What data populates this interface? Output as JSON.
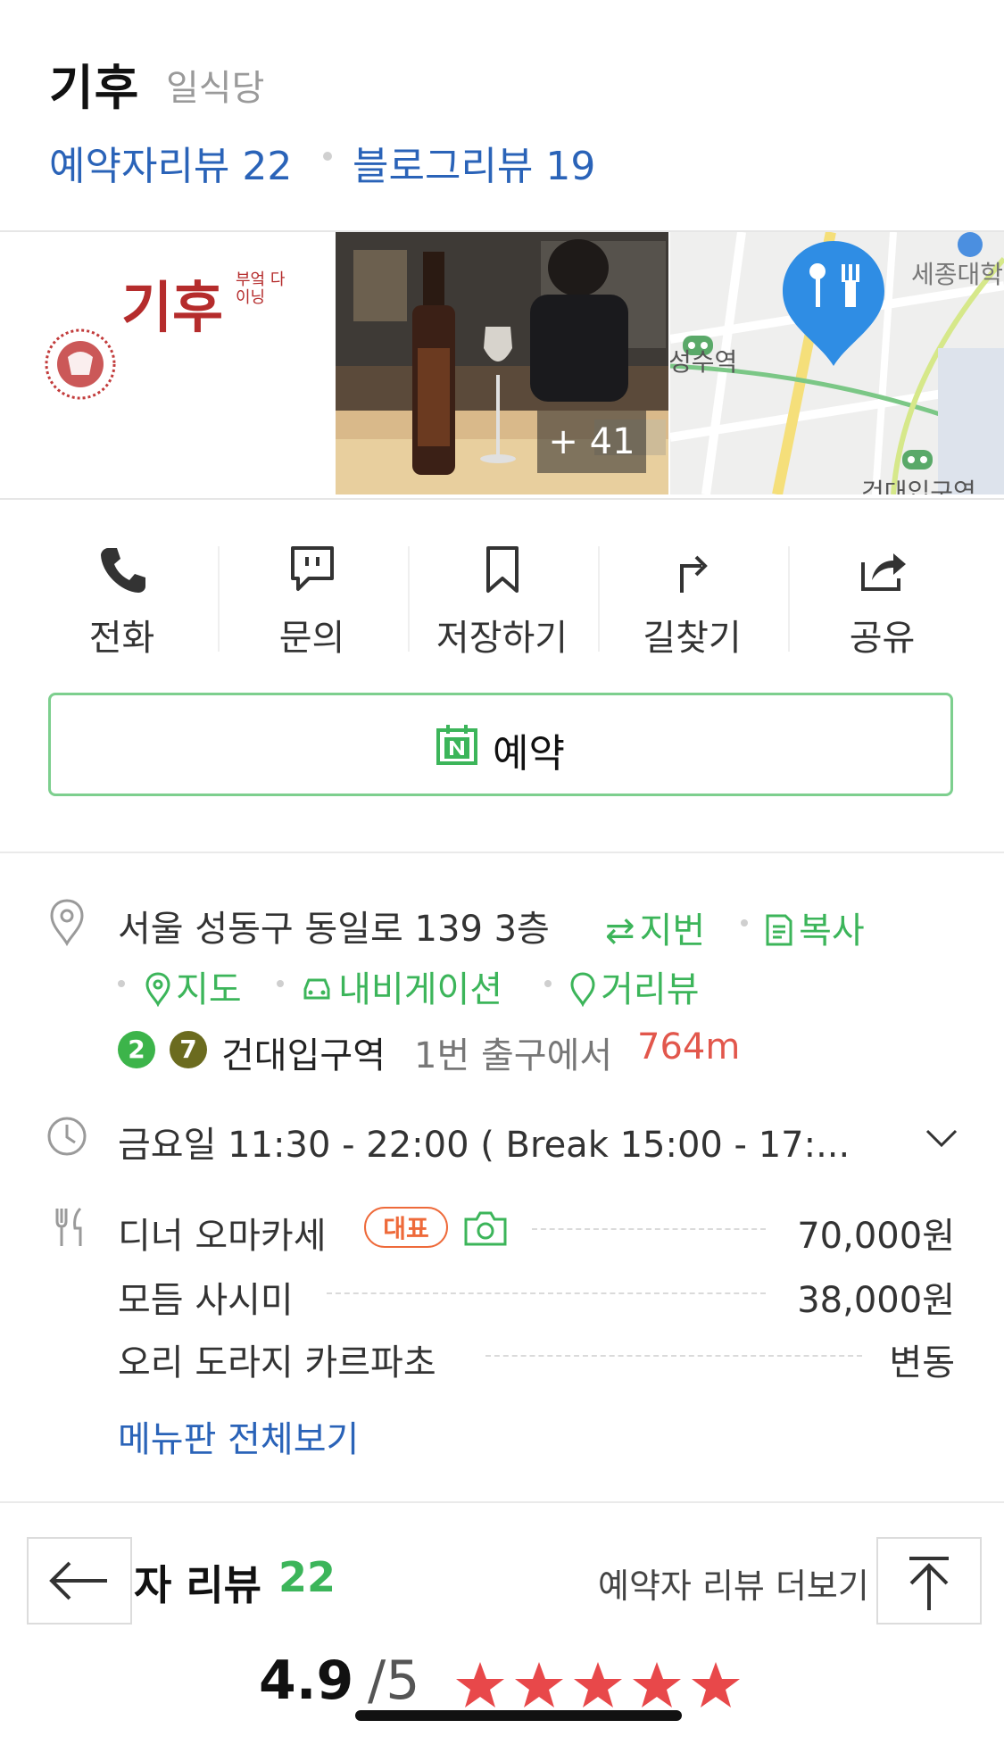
{
  "place": {
    "name": "기후",
    "category": "일식당",
    "booking_review_label": "예약자리뷰 22",
    "blog_review_label": "블로그리뷰 19"
  },
  "media": {
    "logo_text": "기후",
    "logo_sub": "부엌 다이닝",
    "photo_count_label": "+ 41",
    "map_labels": [
      "세종대학",
      "성수역",
      "건대입구역"
    ]
  },
  "actions": [
    {
      "label": "전화",
      "icon": "phone-icon"
    },
    {
      "label": "문의",
      "icon": "chat-icon"
    },
    {
      "label": "저장하기",
      "icon": "bookmark-icon"
    },
    {
      "label": "길찾기",
      "icon": "directions-icon"
    },
    {
      "label": "공유",
      "icon": "share-icon"
    }
  ],
  "reserve": {
    "label": "예약",
    "icon": "naver-booking-icon"
  },
  "address": {
    "text": "서울 성동구 동일로 139 3층",
    "jibun_label": "지번",
    "copy_label": "복사",
    "map_label": "지도",
    "navigation_label": "내비게이션",
    "streetview_label": "거리뷰"
  },
  "subway": {
    "lines": [
      "2",
      "7"
    ],
    "line_colors": [
      "#3cb44a",
      "#6b6b1f"
    ],
    "station": "건대입구역",
    "exit_text": "1번 출구에서",
    "distance": "764m"
  },
  "hours": {
    "text": "금요일 11:30 - 22:00 ( Break 15:00 - 17:..."
  },
  "menu": {
    "items": [
      {
        "name": "디너 오마카세",
        "price": "70,000원",
        "badge": "대표"
      },
      {
        "name": "모듬 사시미",
        "price": "38,000원"
      },
      {
        "name": "오리 도라지 카르파초",
        "price": "변동"
      }
    ],
    "view_all_label": "메뉴판 전체보기"
  },
  "reviews": {
    "title_visible": "자 리뷰",
    "count": "22",
    "more_label": "예약자 리뷰 더보기",
    "rating": "4.9",
    "rating_max": "/5",
    "stars": 5
  },
  "colors": {
    "accent_blue": "#2a63b8",
    "accent_green": "#3cb55a",
    "distance_red": "#e2574c",
    "star_red": "#e8484a"
  }
}
